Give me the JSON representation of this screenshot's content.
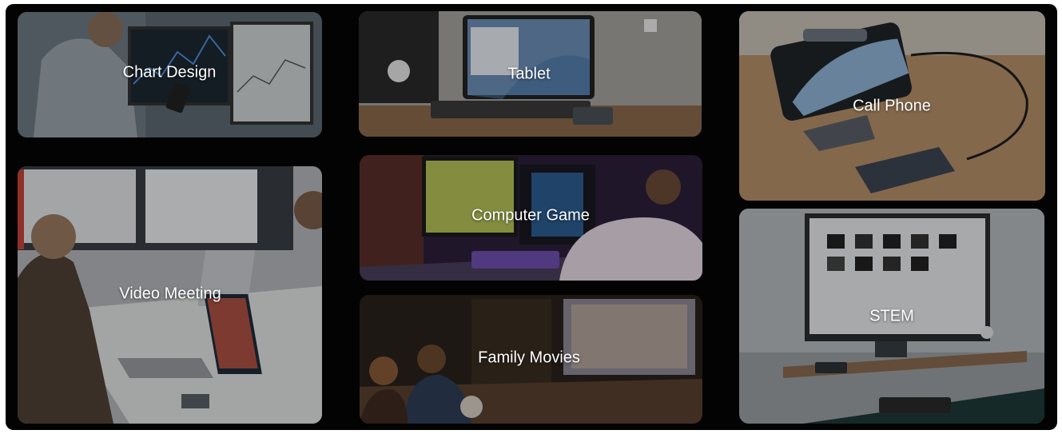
{
  "tiles": [
    {
      "id": "chart-design",
      "label": "Chart Design"
    },
    {
      "id": "tablet",
      "label": "Tablet"
    },
    {
      "id": "call-phone",
      "label": "Call Phone"
    },
    {
      "id": "video-meeting",
      "label": "Video Meeting"
    },
    {
      "id": "computer-game",
      "label": "Computer Game"
    },
    {
      "id": "family-movies",
      "label": "Family Movies"
    },
    {
      "id": "stem",
      "label": "STEM"
    }
  ]
}
